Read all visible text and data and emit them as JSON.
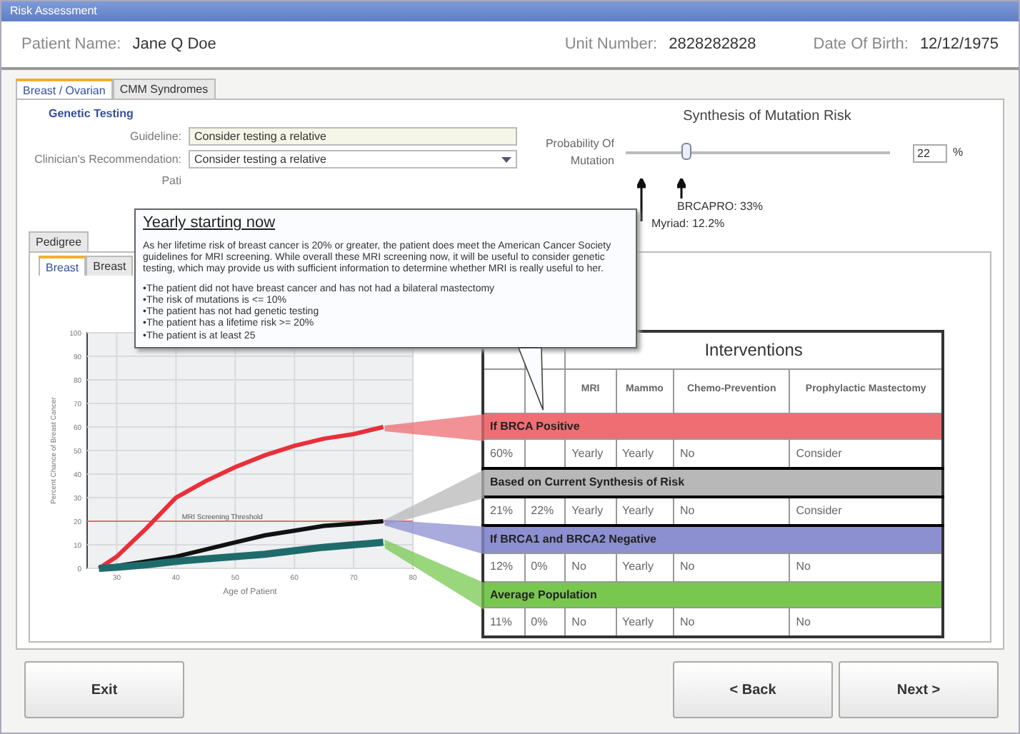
{
  "window": {
    "title": "Risk Assessment"
  },
  "patient": {
    "name_label": "Patient Name:",
    "name": "Jane Q Doe",
    "unit_label": "Unit Number:",
    "unit": "2828282828",
    "dob_label": "Date Of Birth:",
    "dob": "12/12/1975"
  },
  "tabs": [
    {
      "label": "Breast / Ovarian",
      "selected": true
    },
    {
      "label": "CMM Syndromes",
      "selected": false
    }
  ],
  "genetic_testing": {
    "title": "Genetic Testing",
    "guideline_label": "Guideline:",
    "guideline": "Consider testing a relative",
    "recommendation_label": "Clinician's Recommendation:",
    "recommendation": "Consider testing a relative",
    "patient_label": "Pati"
  },
  "risk": {
    "title": "Synthesis of Mutation Risk",
    "slider_label": "Probability Of Mutation",
    "level": 0.22,
    "value": "22",
    "unit": "%",
    "markers": [
      {
        "label": "BRCAPRO: 33%"
      },
      {
        "label": "Myriad: 12.2%"
      }
    ]
  },
  "lower_tabs": [
    {
      "label": "Pedigree",
      "selected": false
    }
  ],
  "sub_tabs": [
    {
      "label": "Breast",
      "selected": true
    },
    {
      "label": "Breast",
      "selected": false
    }
  ],
  "chart": {
    "chart_data": {
      "type": "line",
      "xlabel": "Age of Patient",
      "ylabel": "Percent Chance of Breast Cancer",
      "xlim": [
        25,
        80
      ],
      "ylim": [
        0,
        100
      ],
      "xticks": [
        30,
        40,
        50,
        60,
        70,
        80
      ],
      "yticks": [
        0,
        10,
        20,
        30,
        40,
        50,
        60,
        70,
        80,
        90,
        100
      ],
      "x": [
        27,
        30,
        35,
        40,
        45,
        50,
        55,
        60,
        65,
        70,
        75
      ],
      "grid": true,
      "series": [
        {
          "color": "#e8303a",
          "values": [
            0,
            5,
            17,
            30,
            37,
            43,
            48,
            52,
            55,
            57,
            60
          ]
        },
        {
          "color": "#111111",
          "values": [
            0,
            1,
            3,
            5,
            8,
            11,
            14,
            16,
            18,
            19,
            20
          ]
        },
        {
          "color": "#1f6b6b",
          "values": [
            0,
            0.5,
            1.5,
            3,
            4,
            5,
            6,
            7.5,
            9,
            10,
            11
          ]
        }
      ],
      "ref_lines": [
        {
          "axis": "y",
          "value": 20
        }
      ],
      "annotations": [
        "MRI Screening Threshold"
      ]
    }
  },
  "tooltip": {
    "title": "Yearly starting now",
    "text": "As her lifetime risk of breast cancer is 20% or greater, the patient does meet the American Cancer Society guidelines for MRI screening. While overall these MRI screening now, it will be useful to consider genetic testing, which may provide us with sufficient information to determine whether MRI is really useful to her.",
    "bullets": [
      "•The patient did not have breast cancer and has not had a bilateral mastectomy",
      "•The risk of mutations is <= 10%",
      "•The patient has not had genetic testing",
      "•The patient has a lifetime risk >= 20%",
      "•The patient is at least 25"
    ]
  },
  "table": {
    "header": "Interventions",
    "columns": [
      "MRI",
      "Mammo",
      "Chemo-Prevention",
      "Prophylactic Mastectomy"
    ],
    "groups": [
      {
        "title": "If BRCA Positive",
        "color": "#ee6e73",
        "selected": false,
        "cells": [
          "60%",
          null,
          "Yearly",
          "Yearly",
          "No",
          "Consider"
        ]
      },
      {
        "title": "Based on Current Synthesis of Risk",
        "color": "#b8b8b8",
        "selected": true,
        "cells": [
          "21%",
          "22%",
          "Yearly",
          "Yearly",
          "No",
          "Consider"
        ]
      },
      {
        "title": "If BRCA1 and BRCA2 Negative",
        "color": "#8c8fd0",
        "selected": false,
        "cells": [
          "12%",
          "0%",
          "No",
          "Yearly",
          "No",
          "No"
        ]
      },
      {
        "title": "Average Population",
        "color": "#78c850",
        "selected": false,
        "cells": [
          "11%",
          "0%",
          "No",
          "Yearly",
          "No",
          "No"
        ]
      }
    ]
  },
  "buttons": [
    {
      "label": "Exit"
    },
    {
      "label": "< Back"
    },
    {
      "label": "Next >"
    }
  ]
}
